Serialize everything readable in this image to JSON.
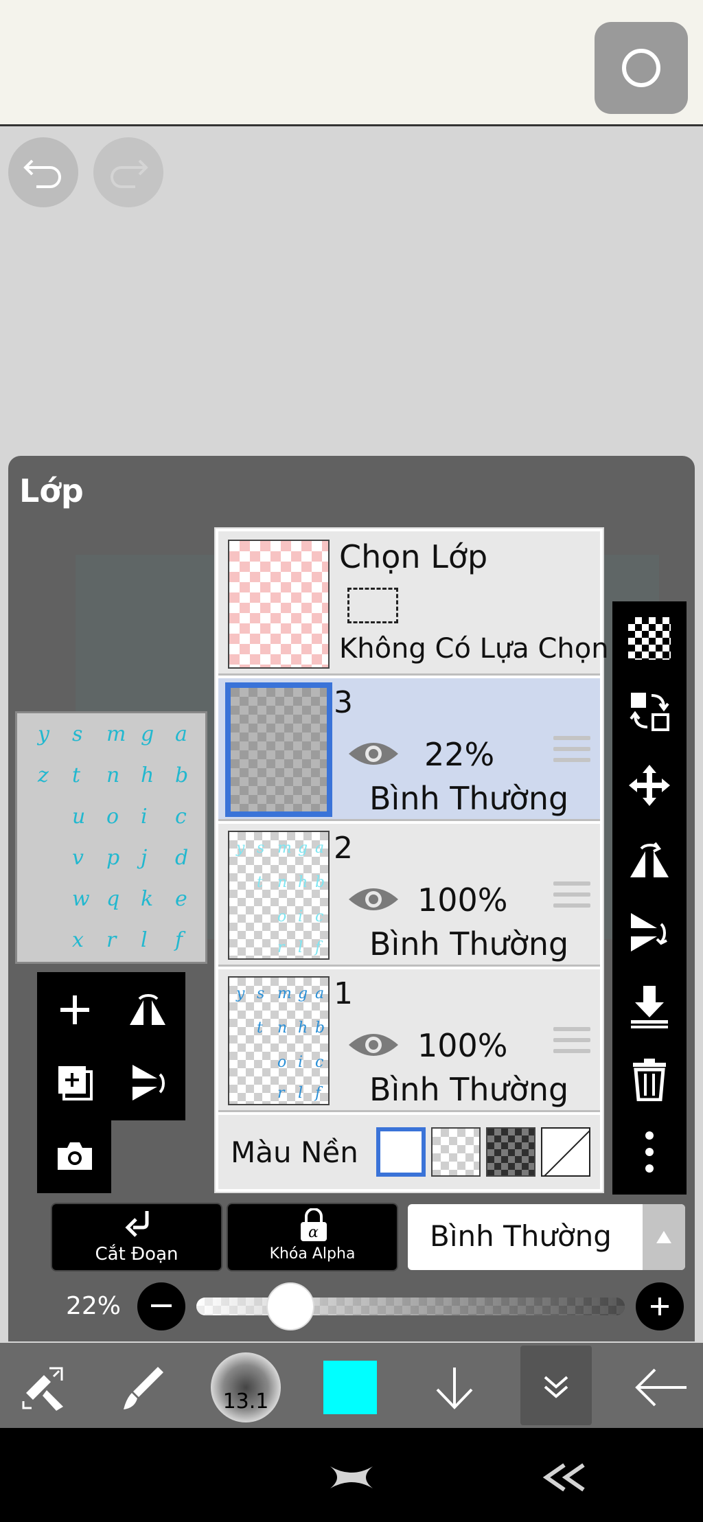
{
  "panel": {
    "title": "Lớp"
  },
  "select_layer": {
    "title": "Chọn Lớp",
    "subtitle": "Không Có Lựa Chọn"
  },
  "layers": [
    {
      "name": "3",
      "opacity": "22%",
      "blend": "Bình Thường",
      "selected": true
    },
    {
      "name": "2",
      "opacity": "100%",
      "blend": "Bình Thường",
      "selected": false
    },
    {
      "name": "1",
      "opacity": "100%",
      "blend": "Bình Thường",
      "selected": false
    }
  ],
  "background": {
    "label": "Màu Nền"
  },
  "actions": {
    "clip_label": "Cắt Đoạn",
    "alpha_lock_label": "Khóa Alpha",
    "blend_mode": "Bình Thường"
  },
  "opacity": {
    "value_text": "22%",
    "value": 0.22
  },
  "toolbar": {
    "brush_size": "13.1",
    "color": "#00ffff"
  },
  "preview_letters": [
    "a",
    "b",
    "c",
    "d",
    "e",
    "f",
    "g",
    "h",
    "i",
    "j",
    "k",
    "l",
    "m",
    "n",
    "o",
    "p",
    "q",
    "r",
    "s",
    "t",
    "u",
    "v",
    "w",
    "x",
    "y",
    "z"
  ],
  "colors": {
    "accent": "#3a73d8",
    "selected_row": "#cfd9ee",
    "panel": "#616161",
    "topbar": "#f4f3ec"
  }
}
